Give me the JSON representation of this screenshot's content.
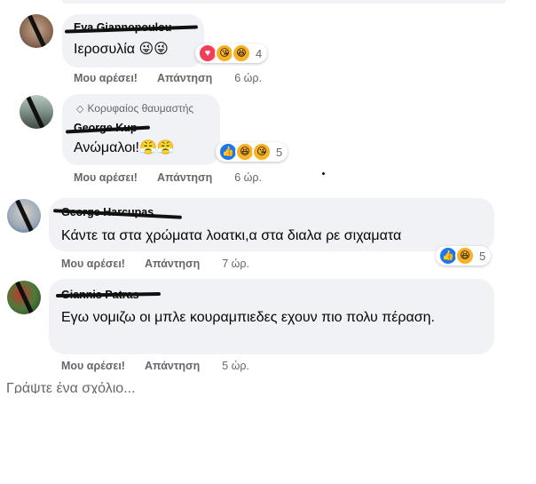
{
  "comments": [
    {
      "author": "Eva Giannopoulou",
      "badge": "",
      "text": "Ιεροσυλία 😜😜",
      "reactions": {
        "icons": [
          "love",
          "haha-care",
          "haha"
        ],
        "count": "4"
      },
      "actions": {
        "like": "Μου αρέσει!",
        "reply": "Απάντηση",
        "time": "6 ώρ."
      }
    },
    {
      "author": "George Kup",
      "badge": "Κορυφαίος θαυμαστής",
      "text": "Ανώμαλοι!😤😤",
      "reactions": {
        "icons": [
          "like",
          "haha",
          "haha-care"
        ],
        "count": "5"
      },
      "actions": {
        "like": "Μου αρέσει!",
        "reply": "Απάντηση",
        "time": "6 ώρ."
      }
    },
    {
      "author": "George Harcupas",
      "badge": "",
      "text": "Κάντε τα στα χρώματα λοατκι,α στα διαλα ρε σιχαματα",
      "reactions": {
        "icons": [
          "like",
          "haha"
        ],
        "count": "5"
      },
      "actions": {
        "like": "Μου αρέσει!",
        "reply": "Απάντηση",
        "time": "7 ώρ."
      }
    },
    {
      "author": "Giannis Patras",
      "badge": "",
      "text": "Εγω νομιζω οι μπλε κουραμπιεδες εχουν πιο πολυ πέραση.",
      "reactions": null,
      "actions": {
        "like": "Μου αρέσει!",
        "reply": "Απάντηση",
        "time": "5 ώρ."
      }
    }
  ],
  "write_comment": {
    "placeholder": "Γράψτε ένα σχόλιο..."
  },
  "colors": {
    "bubble": "#f0f2f5",
    "meta": "#65676b",
    "like_blue": "#1877f2",
    "love_red": "#f33e58",
    "haha_yellow": "#f7b125"
  }
}
